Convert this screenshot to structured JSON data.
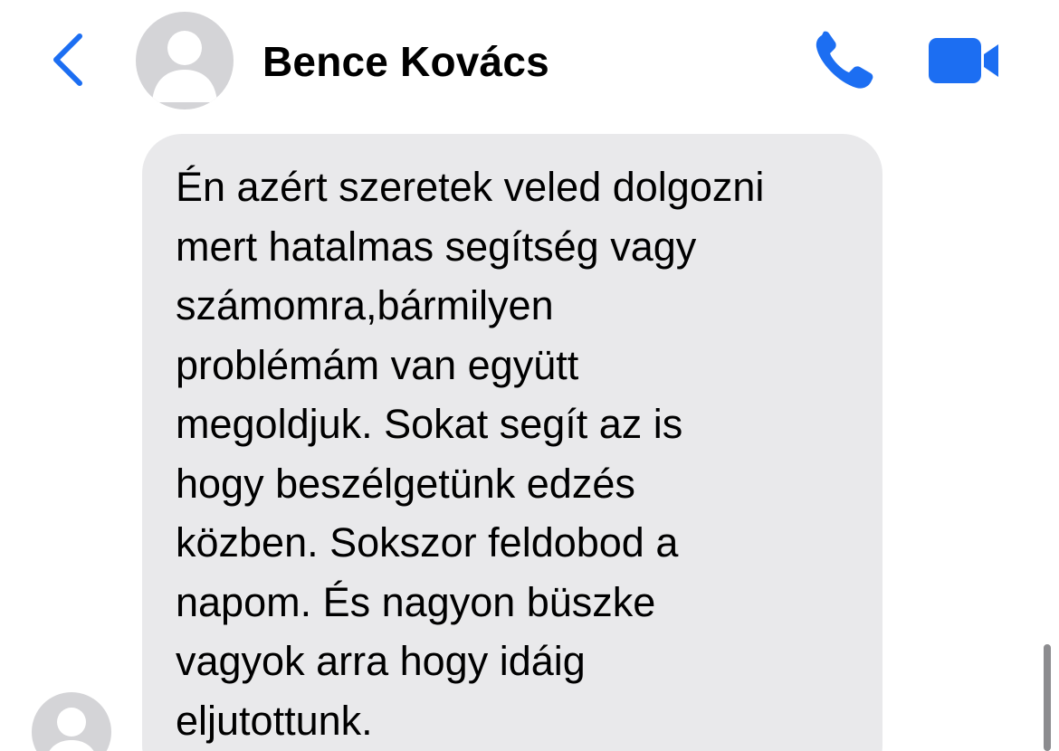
{
  "header": {
    "contact_name": "Bence Kovács",
    "back_icon": "chevron-left-icon",
    "call_icon": "phone-icon",
    "video_icon": "video-camera-icon",
    "accent_color": "#1c6ef2"
  },
  "message": {
    "text": "Én azért szeretek veled dolgozni\nmert hatalmas segítség vagy\nszámomra,bármilyen\nproblémám van együtt\nmegoldjuk. Sokat segít az is\nhogy beszélgetünk edzés\nközben. Sokszor feldobod a\nnapom. És nagyon büszke\nvagyok arra hogy idáig\neljutottunk.",
    "bubble_color": "#e9e9eb"
  }
}
